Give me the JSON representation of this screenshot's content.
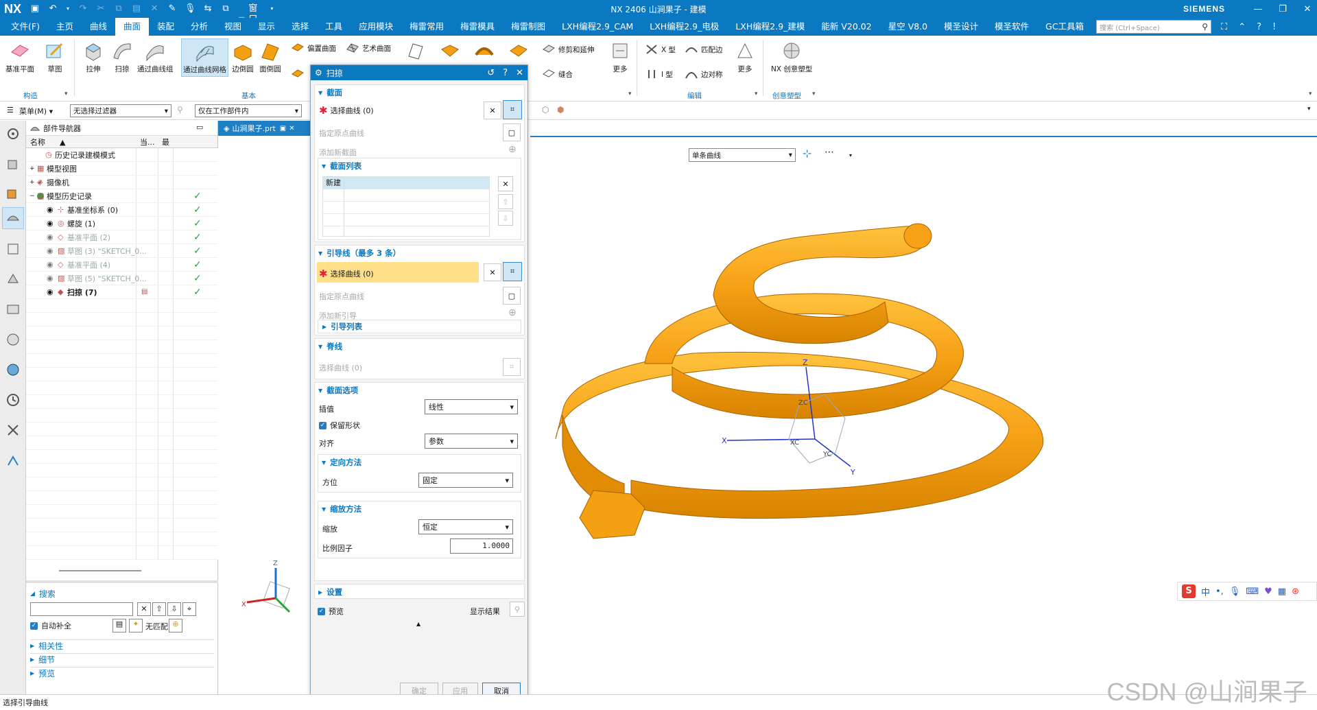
{
  "titlebar": {
    "logo": "NX",
    "title": "NX 2406  山涧果子 - 建模",
    "brand": "SIEMENS",
    "window_menu": "窗口"
  },
  "menubar": {
    "items": [
      "文件(F)",
      "主页",
      "曲线",
      "曲面",
      "装配",
      "分析",
      "视图",
      "显示",
      "选择",
      "工具",
      "应用模块",
      "梅雷常用",
      "梅雷模具",
      "梅雷制图",
      "LXH编程2.9_CAM",
      "LXH编程2.9_电极",
      "LXH编程2.9_建模",
      "能新 V20.02",
      "星空 V8.0",
      "模圣设计",
      "模圣软件",
      "GC工具箱"
    ],
    "active_index": 3,
    "search_placeholder": "搜索 (Ctrl+Space)"
  },
  "ribbon": {
    "construct": {
      "datum_plane": "基准平面",
      "sketch": "草图",
      "group": "构造"
    },
    "basic": {
      "extrude": "拉伸",
      "sweep": "扫掠",
      "through_curves": "通过曲线组",
      "through_mesh": "通过曲线网格",
      "edge_blend": "边倒圆",
      "face_blend": "面倒圆",
      "offset_surface": "偏置曲面",
      "styled_surface": "艺术曲面",
      "group": "基本"
    },
    "trim": {
      "trim_extend": "修剪和延伸",
      "sew": "缝合",
      "more": "更多",
      "partial": "本"
    },
    "edit": {
      "x_form": "X 型",
      "match_edge": "匹配边",
      "i_form": "I 型",
      "edge_symmetry": "边对称",
      "more": "更多",
      "group": "编辑"
    },
    "nx_creative": {
      "label": "NX 创意塑型",
      "group": "创意塑型"
    }
  },
  "filterbar": {
    "menu": "菜单(M)",
    "filter": "无选择过滤器",
    "scope": "仅在工作部件内"
  },
  "navigator": {
    "title": "部件导航器",
    "col_name": "名称",
    "col_current": "当...",
    "col_latest": "最",
    "rows": [
      {
        "label": "历史记录建模模式",
        "dim": false,
        "check": false
      },
      {
        "label": "模型视图",
        "dim": false,
        "check": false
      },
      {
        "label": "摄像机",
        "dim": false,
        "check": false
      },
      {
        "label": "模型历史记录",
        "dim": false,
        "check": true
      },
      {
        "label": "基准坐标系 (0)",
        "dim": false,
        "check": true
      },
      {
        "label": "螺旋 (1)",
        "dim": false,
        "check": true
      },
      {
        "label": "基准平面 (2)",
        "dim": true,
        "check": true
      },
      {
        "label": "草图 (3) \"SKETCH_0...",
        "dim": true,
        "check": true
      },
      {
        "label": "基准平面 (4)",
        "dim": true,
        "check": true
      },
      {
        "label": "草图 (5) \"SKETCH_0...",
        "dim": true,
        "check": true
      },
      {
        "label": "扫掠 (7)",
        "dim": false,
        "check": true
      }
    ],
    "search_title": "搜索",
    "autocomplete": "自动补全",
    "no_match": "无匹配",
    "sections": [
      "相关性",
      "细节",
      "预览"
    ]
  },
  "doctab": {
    "label": "山涧果子.prt"
  },
  "graphics": {
    "curve_filter": "单条曲线",
    "axis_labels": {
      "x": "X",
      "y": "Y",
      "z": "Z",
      "xc": "XC",
      "yc": "YC",
      "zc": "ZC"
    }
  },
  "dialog": {
    "title": "扫掠",
    "section": {
      "header": "截面",
      "select": "选择曲线 (0)",
      "origin": "指定原点曲线",
      "add": "添加新截面"
    },
    "section_list": {
      "header": "截面列表",
      "new": "新建"
    },
    "guide": {
      "header": "引导线（最多 3 条）",
      "select": "选择曲线 (0)",
      "origin": "指定原点曲线",
      "add": "添加新引导",
      "list": "引导列表"
    },
    "spine": {
      "header": "脊线",
      "select": "选择曲线 (0)"
    },
    "options": {
      "header": "截面选项",
      "interp_label": "插值",
      "interp_value": "线性",
      "keep_shape": "保留形状",
      "align_label": "对齐",
      "align_value": "参数",
      "orient_header": "定向方法",
      "orient_label": "方位",
      "orient_value": "固定",
      "scale_header": "缩放方法",
      "scale_label": "缩放",
      "scale_value": "恒定",
      "ratio_label": "比例因子",
      "ratio_value": "1.0000"
    },
    "settings": "设置",
    "preview": "预览",
    "show_result": "显示结果",
    "ok": "确定",
    "apply": "应用",
    "cancel": "取消"
  },
  "status": {
    "text": "选择引导曲线"
  },
  "ime": {
    "lang": "中"
  },
  "watermark": "CSDN @山涧果子",
  "colors": {
    "nx_blue": "#0b78c2",
    "spring": "#f3a012",
    "highlight": "#ffdf88"
  }
}
